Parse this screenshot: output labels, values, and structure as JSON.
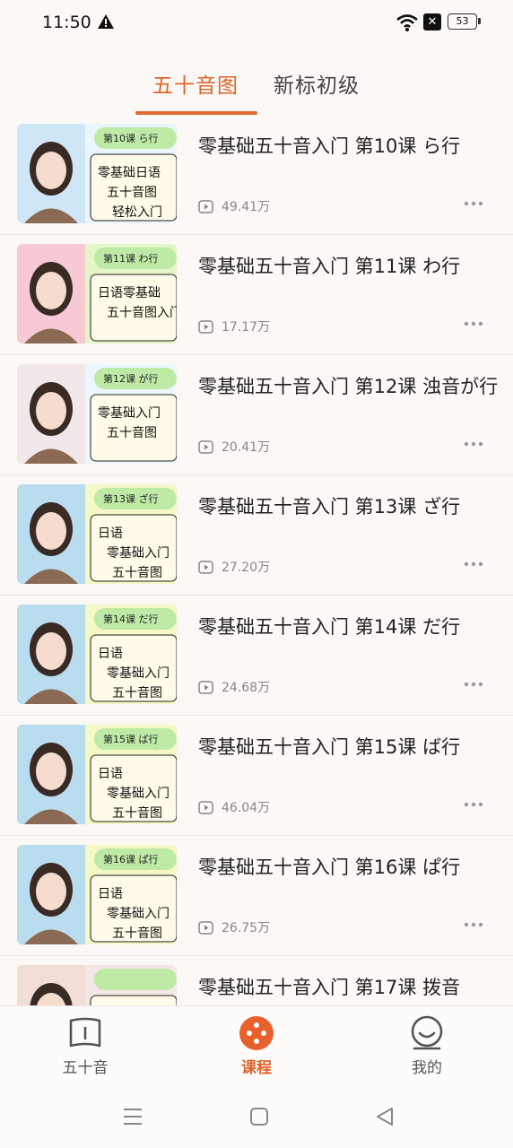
{
  "status_bar": {
    "time": "11:50",
    "battery": "53"
  },
  "tabs": [
    {
      "label": "五十音图",
      "active": true
    },
    {
      "label": "新标初级",
      "active": false
    }
  ],
  "lessons": [
    {
      "title": "零基础五十音入门 第10课 ら行",
      "views": "49.41万",
      "thumb": {
        "tag": "第10课 ら行",
        "line1": "零基础日语",
        "line2": "五十音图",
        "line3": "轻松入门"
      }
    },
    {
      "title": "零基础五十音入门 第11课 わ行",
      "views": "17.17万",
      "thumb": {
        "tag": "第11课 わ行",
        "line1": "日语零基础",
        "line2": "五十音图入门",
        "line3": ""
      }
    },
    {
      "title": "零基础五十音入门 第12课 浊音が行",
      "views": "20.41万",
      "thumb": {
        "tag": "第12课 が行",
        "line1": "零基础入门",
        "line2": "五十音图",
        "line3": ""
      }
    },
    {
      "title": "零基础五十音入门 第13课 ざ行",
      "views": "27.20万",
      "thumb": {
        "tag": "第13课 ざ行",
        "line1": "日语",
        "line2": "零基础入门",
        "line3": "五十音图"
      }
    },
    {
      "title": "零基础五十音入门 第14课 だ行",
      "views": "24.68万",
      "thumb": {
        "tag": "第14课 だ行",
        "line1": "日语",
        "line2": "零基础入门",
        "line3": "五十音图"
      }
    },
    {
      "title": "零基础五十音入门 第15课 ば行",
      "views": "46.04万",
      "thumb": {
        "tag": "第15课 ば行",
        "line1": "日语",
        "line2": "零基础入门",
        "line3": "五十音图"
      }
    },
    {
      "title": "零基础五十音入门 第16课 ぱ行",
      "views": "26.75万",
      "thumb": {
        "tag": "第16课 ぱ行",
        "line1": "日语",
        "line2": "零基础入门",
        "line3": "五十音图"
      }
    },
    {
      "title": "零基础五十音入门 第17课 拨音",
      "views": "",
      "thumb": {
        "tag": "",
        "line1": "",
        "line2": "",
        "line3": ""
      }
    }
  ],
  "bottom_nav": [
    {
      "label": "五十音",
      "icon": "book-icon",
      "active": false
    },
    {
      "label": "课程",
      "icon": "course-icon",
      "active": true
    },
    {
      "label": "我的",
      "icon": "smile-icon",
      "active": false
    }
  ],
  "colors": {
    "accent": "#e0622a",
    "background": "#fbf8f5"
  }
}
